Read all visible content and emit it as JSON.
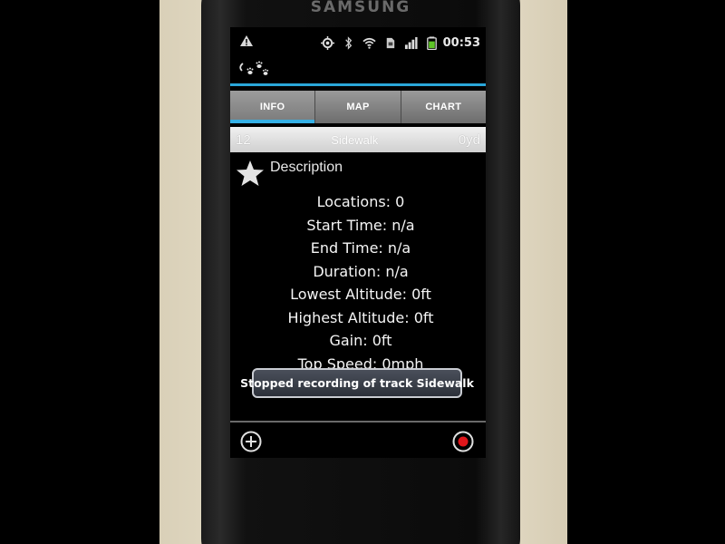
{
  "device": {
    "brand": "SAMSUNG"
  },
  "statusbar": {
    "clock": "00:53",
    "icons": [
      "warning-icon",
      "gps-icon",
      "bluetooth-icon",
      "wifi-icon",
      "sim-icon",
      "signal-icon",
      "battery-icon"
    ]
  },
  "app": {
    "icon": "paw-prints-icon"
  },
  "tabs": [
    {
      "label": "INFO",
      "active": true
    },
    {
      "label": "MAP",
      "active": false
    },
    {
      "label": "CHART",
      "active": false
    }
  ],
  "track": {
    "number": "12",
    "name": "Sidewalk",
    "distance": "0yd"
  },
  "description": {
    "label": "Description",
    "stats": [
      "Locations: 0",
      "Start Time: n/a",
      "End Time: n/a",
      "Duration: n/a",
      "Lowest Altitude: 0ft",
      "Highest Altitude: 0ft",
      "Gain: 0ft",
      "Top Speed: 0mph"
    ]
  },
  "toast": {
    "message": "Stopped recording of track Sidewalk"
  },
  "bottom": {
    "add_icon": "add-circle-icon",
    "record_icon": "record-icon"
  },
  "colors": {
    "accent": "#36b1e6",
    "record": "#e0161b"
  }
}
